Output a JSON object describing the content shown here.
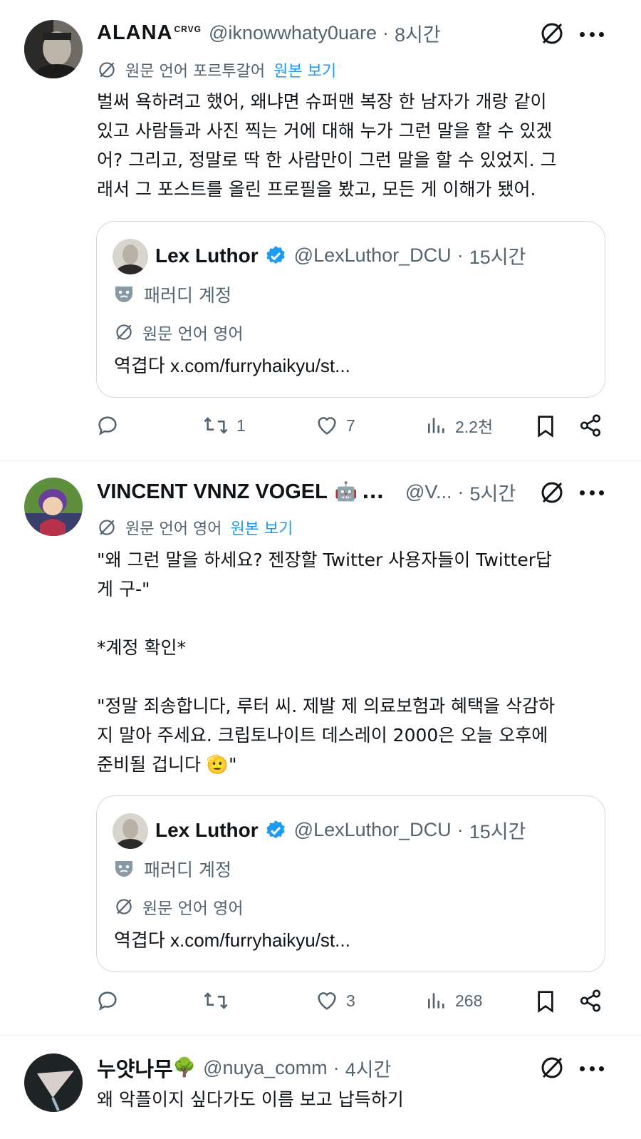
{
  "colors": {
    "accent": "#1d9bf0",
    "secondary_text": "#536471",
    "border": "#cfd9de"
  },
  "tweets": [
    {
      "author": {
        "name": "ALANA",
        "name_sup": "crvg",
        "handle": "@iknowwhaty0uare",
        "time": "8시간"
      },
      "translation": {
        "label": "원문 언어 포르투갈어",
        "show_original": "원본 보기"
      },
      "body": [
        "벌써 욕하려고 했어, 왜냐면 슈퍼맨 복장 한 남자가 개랑 같이",
        "있고 사람들과 사진 찍는 거에 대해 누가 그런 말을 할 수 있겠",
        "어? 그리고, 정말로 딱 한 사람만이 그런 말을 할 수 있었지. 그",
        "래서 그 포스트를 올린 프로필을 봤고, 모든 게 이해가 됐어."
      ],
      "quote": {
        "name": "Lex Luthor",
        "handle": "@LexLuthor_DCU",
        "time": "15시간",
        "parody": "패러디 계정",
        "lang": "원문 언어 영어",
        "text": "역겹다 x.com/furryhaikyu/st..."
      },
      "stats": {
        "replies": "",
        "retweets": "1",
        "likes": "7",
        "views": "2.2천"
      }
    },
    {
      "author": {
        "name": "VINCENT VNNZ VOGEL",
        "emoji": "🤖",
        "ellipsis": "...",
        "handle": "@V...",
        "time": "5시간"
      },
      "translation": {
        "label": "원문 언어 영어",
        "show_original": "원본 보기"
      },
      "body": [
        "\"왜 그런 말을 하세요? 젠장할 Twitter 사용자들이 Twitter답",
        "게 구-\"",
        "",
        "*계정 확인*",
        "",
        "\"정말 죄송합니다, 루터 씨. 제발 제 의료보험과 혜택을 삭감하",
        "지 말아 주세요. 크립토나이트 데스레이 2000은 오늘 오후에",
        "준비될 겁니다 🫡\""
      ],
      "quote": {
        "name": "Lex Luthor",
        "handle": "@LexLuthor_DCU",
        "time": "15시간",
        "parody": "패러디 계정",
        "lang": "원문 언어 영어",
        "text": "역겹다 x.com/furryhaikyu/st..."
      },
      "stats": {
        "replies": "",
        "retweets": "",
        "likes": "3",
        "views": "268"
      }
    },
    {
      "author": {
        "name": "누얏나무",
        "emoji": "🌳",
        "handle": "@nuya_comm",
        "time": "4시간"
      },
      "body": [
        "왜 악플이지 싶다가도 이름 보고 납득하기"
      ]
    }
  ],
  "icons": [
    "translate-icon",
    "more-icon",
    "reply-icon",
    "retweet-icon",
    "like-icon",
    "views-icon",
    "bookmark-icon",
    "share-icon",
    "verified-icon",
    "parody-mask-icon"
  ]
}
